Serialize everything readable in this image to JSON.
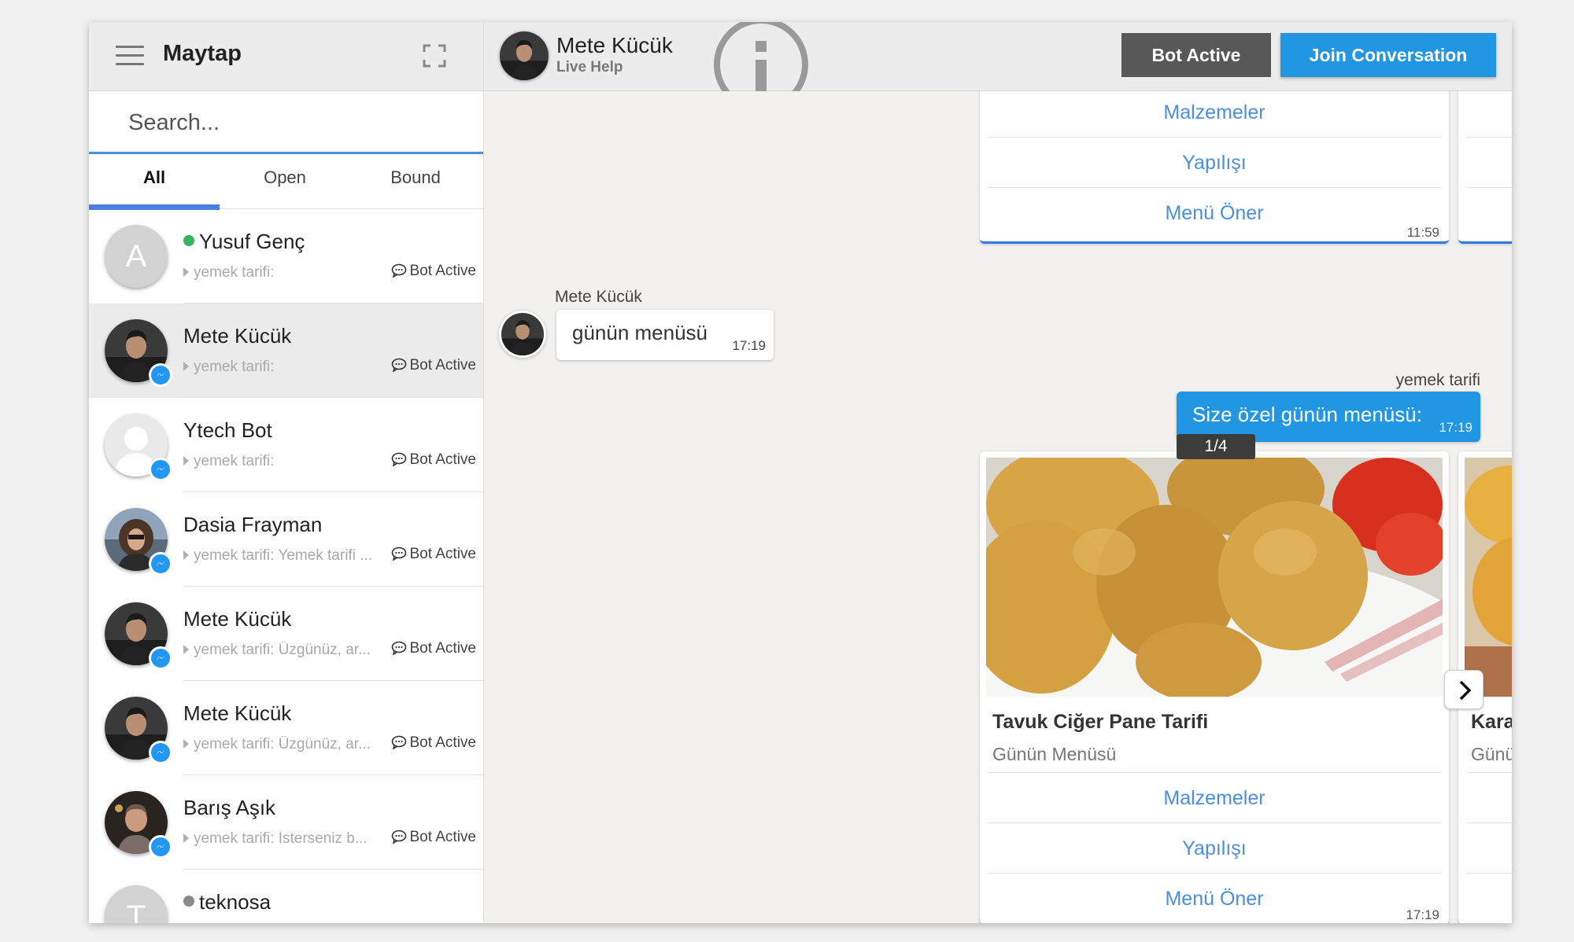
{
  "sidebar": {
    "title": "Maytap",
    "search_placeholder": "Search...",
    "tabs": [
      {
        "label": "All",
        "active": true
      },
      {
        "label": "Open",
        "active": false
      },
      {
        "label": "Bound",
        "active": false
      }
    ],
    "conversations": [
      {
        "name": "Yusuf Genç",
        "avatar": "letter",
        "letter": "A",
        "presence": "online",
        "presence_color": "#35b35a",
        "messenger": false,
        "preview": "yemek tarifi:",
        "status": "Bot Active"
      },
      {
        "name": "Mete Kücük",
        "avatar": "photo",
        "messenger": true,
        "selected": true,
        "preview": "yemek tarifi:",
        "status": "Bot Active"
      },
      {
        "name": "Ytech Bot",
        "avatar": "default-person",
        "messenger": true,
        "preview": "yemek tarifi:",
        "status": "Bot Active"
      },
      {
        "name": "Dasia Frayman",
        "avatar": "photo",
        "messenger": true,
        "preview": "yemek tarifi: Yemek tarifi ...",
        "status": "Bot Active"
      },
      {
        "name": "Mete Kücük",
        "avatar": "photo",
        "messenger": true,
        "preview": "yemek tarifi: Üzgünüz, ar...",
        "status": "Bot Active"
      },
      {
        "name": "Mete Kücük",
        "avatar": "photo",
        "messenger": true,
        "preview": "yemek tarifi: Üzgünüz, ar...",
        "status": "Bot Active"
      },
      {
        "name": "Barış Aşık",
        "avatar": "photo",
        "messenger": true,
        "preview": "yemek tarifi: İsterseniz b...",
        "status": "Bot Active"
      },
      {
        "name": "teknosa",
        "avatar": "letter",
        "letter": "T",
        "presence": "offline",
        "presence_color": "#8a8a8a",
        "messenger": false,
        "preview": "",
        "status": ""
      }
    ]
  },
  "header": {
    "name": "Mete Kücük",
    "subtitle": "Live Help",
    "bot_button": "Bot Active",
    "join_button": "Join Conversation"
  },
  "chat": {
    "top_card": {
      "buttons": [
        "Malzemeler",
        "Yapılışı",
        "Menü Öner"
      ],
      "time": "11:59"
    },
    "incoming": {
      "sender": "Mete Kücük",
      "text": "günün menüsü",
      "time": "17:19"
    },
    "outgoing": {
      "sender": "yemek tarifi",
      "text": "Size özel günün menüsü:",
      "time": "17:19"
    },
    "carousel": {
      "counter": "1/4",
      "card": {
        "title": "Tavuk Ciğer Pane Tarifi",
        "subtitle": "Günün Menüsü",
        "buttons": [
          "Malzemeler",
          "Yapılışı",
          "Menü Öner"
        ],
        "time": "17:19"
      },
      "next_card": {
        "title": "Kara",
        "subtitle": "Günü"
      }
    }
  },
  "colors": {
    "accent": "#2196e3",
    "bot_button": "#585858",
    "link": "#4a8fe0",
    "chat_bg": "#f3f1ef"
  }
}
